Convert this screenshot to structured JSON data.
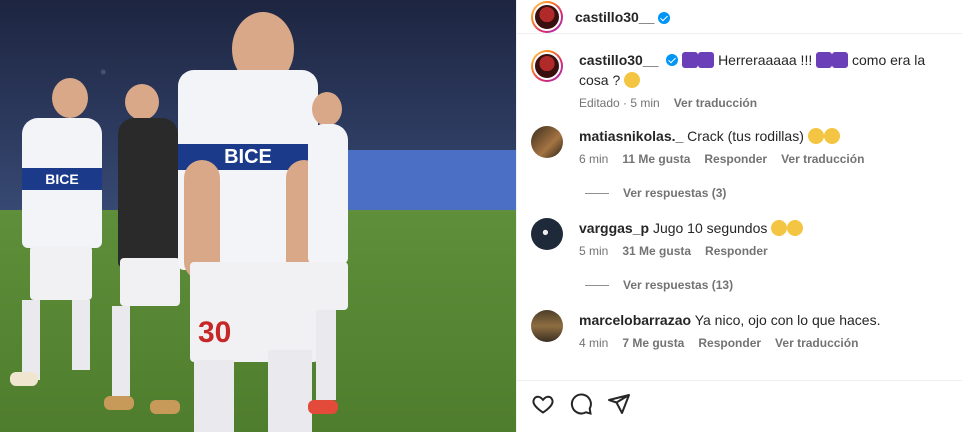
{
  "post": {
    "author": "castillo30__",
    "caption": {
      "username": "castillo30__",
      "text_before": "Herreraaaaa !!!",
      "text_middle": "como era la cosa ?",
      "time": "Editado · 5 min",
      "translate": "Ver traducción"
    },
    "photo": {
      "shirt_text": "BICE",
      "number": "30"
    }
  },
  "comments": [
    {
      "username": "matiasnikolas._",
      "text": "Crack (tus rodillas)",
      "time": "6 min",
      "likes": "11 Me gusta",
      "reply": "Responder",
      "translate": "Ver traducción",
      "replies_label": "Ver respuestas (3)"
    },
    {
      "username": "varggas_p",
      "text": "Jugo 10 segundos",
      "time": "5 min",
      "likes": "31 Me gusta",
      "reply": "Responder",
      "replies_label": "Ver respuestas (13)"
    },
    {
      "username": "marcelobarrazao",
      "text": "Ya nico, ojo con lo que haces.",
      "time": "4 min",
      "likes": "7 Me gusta",
      "reply": "Responder",
      "translate": "Ver traducción"
    }
  ],
  "actions": {
    "like_icon": "heart-icon",
    "comment_icon": "comment-icon",
    "share_icon": "share-icon"
  },
  "colors": {
    "verified": "#0095f6",
    "text": "#262626",
    "secondary": "#737373"
  }
}
